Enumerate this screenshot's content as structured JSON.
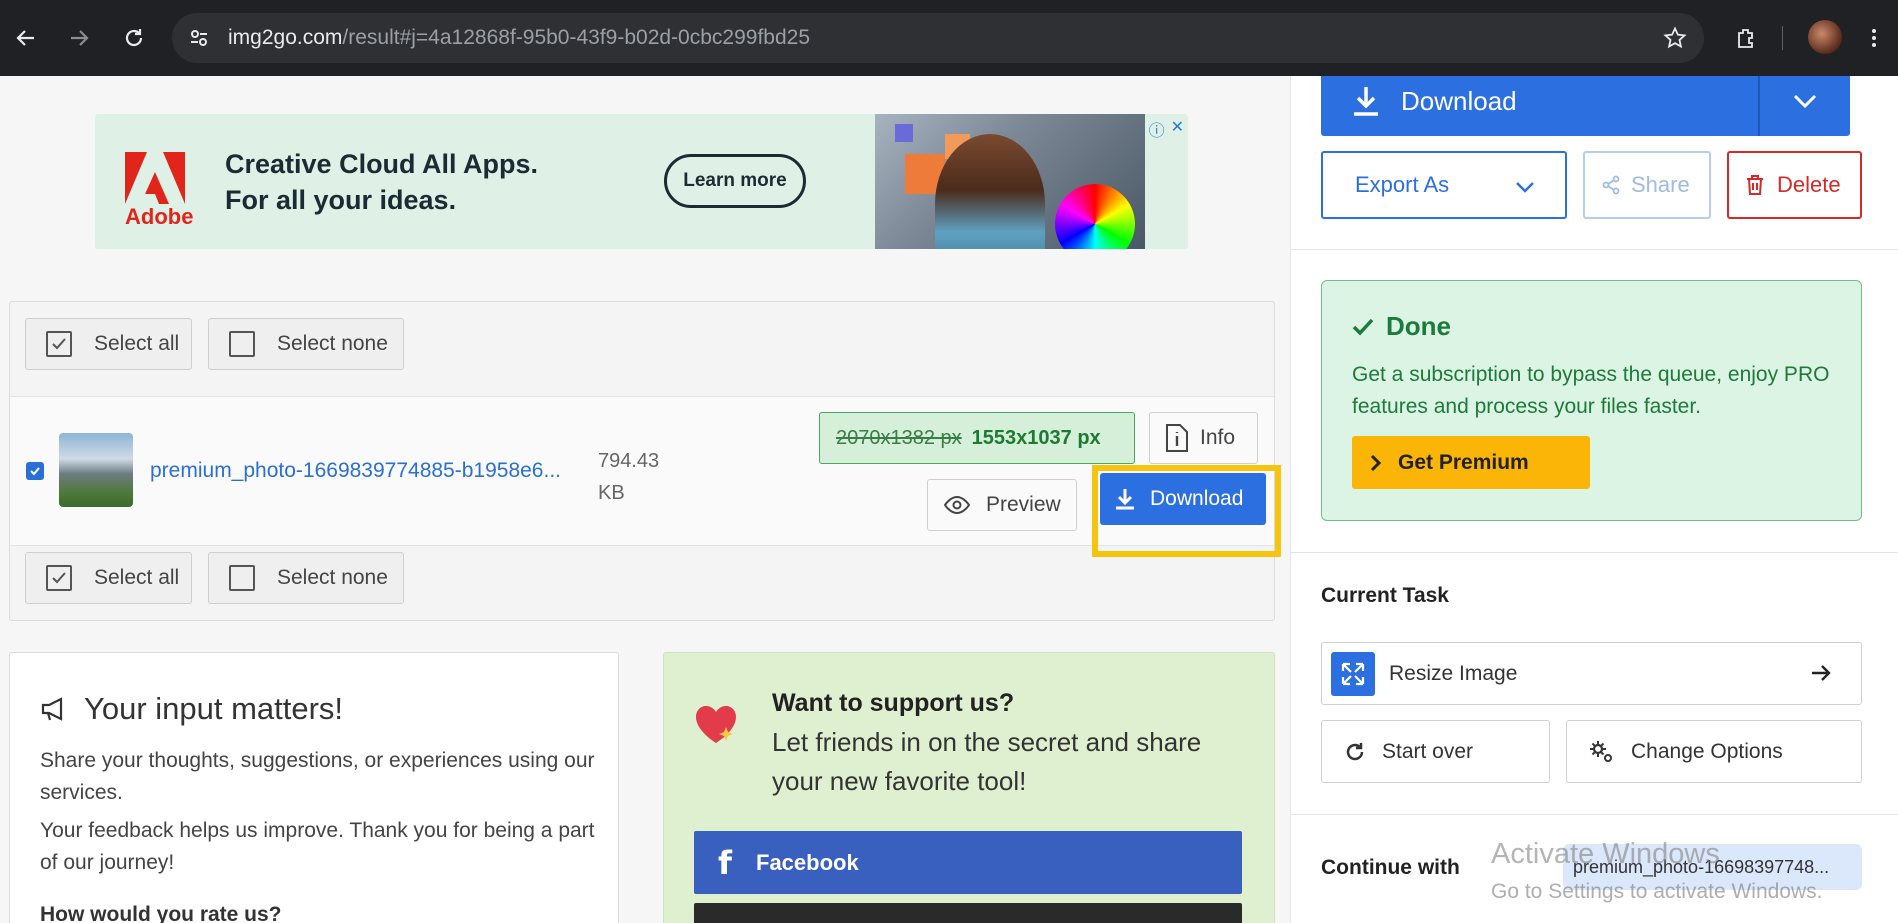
{
  "browser": {
    "url_host": "img2go.com",
    "url_path": "/result#j=4a12868f-95b0-43f9-b02d-0cbc299fbd25"
  },
  "ad": {
    "brand": "Adobe",
    "headline_line1": "Creative Cloud All Apps.",
    "headline_line2": "For all your ideas.",
    "cta": "Learn more"
  },
  "file_list": {
    "select_all": "Select all",
    "select_none": "Select none",
    "file": {
      "name": "premium_photo-1669839774885-b1958e6...",
      "size_line1": "794.43",
      "size_line2": "KB",
      "old_dims": "2070x1382 px",
      "new_dims": "1553x1037 px",
      "checked": true
    },
    "info_label": "Info",
    "preview_label": "Preview",
    "download_label": "Download"
  },
  "feedback": {
    "title": "Your input matters!",
    "p1": "Share your thoughts, suggestions, or experiences using our services.",
    "p2": "Your feedback helps us improve. Thank you for being a part of our journey!",
    "rate": "How would you rate us?"
  },
  "support": {
    "heading": "Want to support us?",
    "text": "Let friends in on the secret and share your new favorite tool!",
    "facebook": "Facebook"
  },
  "sidebar": {
    "download": "Download",
    "export_as": "Export As",
    "share": "Share",
    "delete": "Delete",
    "done_title": "Done",
    "done_text": "Get a subscription to bypass the queue, enjoy PRO features and process your files faster.",
    "get_premium": "Get Premium",
    "current_task": "Current Task",
    "task_name": "Resize Image",
    "start_over": "Start over",
    "change_options": "Change Options",
    "continue_with": "Continue with",
    "continue_chip": "premium_photo-16698397748..."
  },
  "os_watermark": {
    "line1": "Activate Windows",
    "line2": "Go to Settings to activate Windows."
  },
  "colors": {
    "primary": "#2b6fe0",
    "danger": "#d62828",
    "success": "#1c7a3a",
    "premium": "#fbb507",
    "highlight": "#f5c40f",
    "facebook": "#3a60bf"
  }
}
